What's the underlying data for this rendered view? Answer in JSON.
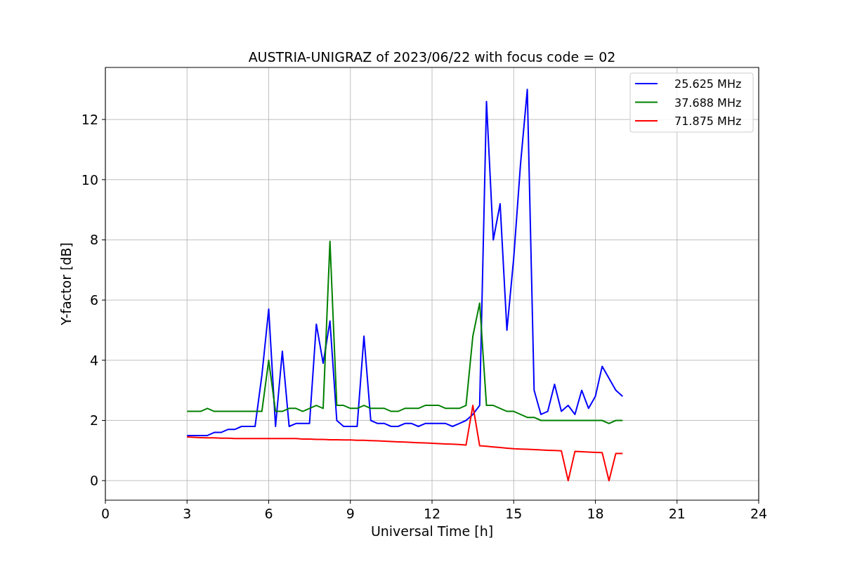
{
  "chart_data": {
    "type": "line",
    "title": "AUSTRIA-UNIGRAZ of 2023/06/22 with focus code = 02",
    "xlabel": "Universal Time [h]",
    "ylabel": "Y-factor [dB]",
    "x": [
      3,
      3.25,
      3.5,
      3.75,
      4,
      4.25,
      4.5,
      4.75,
      5,
      5.25,
      5.5,
      5.75,
      6,
      6.25,
      6.5,
      6.75,
      7,
      7.25,
      7.5,
      7.75,
      8,
      8.25,
      8.5,
      8.75,
      9,
      9.25,
      9.5,
      9.75,
      10,
      10.25,
      10.5,
      10.75,
      11,
      11.25,
      11.5,
      11.75,
      12,
      12.25,
      12.5,
      12.75,
      13,
      13.25,
      13.5,
      13.75,
      14,
      14.25,
      14.5,
      14.75,
      15,
      15.25,
      15.5,
      15.75,
      16,
      16.25,
      16.5,
      16.75,
      17,
      17.25,
      17.5,
      17.75,
      18,
      18.25,
      18.5,
      18.75,
      19
    ],
    "series": [
      {
        "name": "25.625 MHz",
        "color": "#0000ff",
        "values": [
          1.5,
          1.5,
          1.5,
          1.5,
          1.6,
          1.6,
          1.7,
          1.7,
          1.8,
          1.8,
          1.8,
          3.5,
          5.7,
          1.8,
          4.3,
          1.8,
          1.9,
          1.9,
          1.9,
          5.2,
          3.9,
          5.3,
          2.0,
          1.8,
          1.8,
          1.8,
          4.8,
          2.0,
          1.9,
          1.9,
          1.8,
          1.8,
          1.9,
          1.9,
          1.8,
          1.9,
          1.9,
          1.9,
          1.9,
          1.8,
          1.9,
          2.0,
          2.2,
          2.5,
          12.6,
          8.0,
          9.2,
          5.0,
          7.4,
          10.5,
          13.0,
          3.0,
          2.2,
          2.3,
          3.2,
          2.3,
          2.5,
          2.2,
          3.0,
          2.4,
          2.8,
          3.8,
          3.4,
          3.0,
          2.8
        ]
      },
      {
        "name": "37.688 MHz",
        "color": "#008000",
        "values": [
          2.3,
          2.3,
          2.3,
          2.4,
          2.3,
          2.3,
          2.3,
          2.3,
          2.3,
          2.3,
          2.3,
          2.3,
          4.0,
          2.3,
          2.3,
          2.4,
          2.4,
          2.3,
          2.4,
          2.5,
          2.4,
          7.95,
          2.5,
          2.5,
          2.4,
          2.4,
          2.5,
          2.4,
          2.4,
          2.4,
          2.3,
          2.3,
          2.4,
          2.4,
          2.4,
          2.5,
          2.5,
          2.5,
          2.4,
          2.4,
          2.4,
          2.5,
          4.8,
          5.9,
          2.5,
          2.5,
          2.4,
          2.3,
          2.3,
          2.2,
          2.1,
          2.1,
          2.0,
          2.0,
          2.0,
          2.0,
          2.0,
          2.0,
          2.0,
          2.0,
          2.0,
          2.0,
          1.9,
          2.0,
          2.0
        ]
      },
      {
        "name": "71.875 MHz",
        "color": "#ff0000",
        "values": [
          1.45,
          1.44,
          1.43,
          1.42,
          1.42,
          1.41,
          1.41,
          1.4,
          1.4,
          1.4,
          1.4,
          1.4,
          1.4,
          1.4,
          1.4,
          1.4,
          1.4,
          1.38,
          1.38,
          1.37,
          1.37,
          1.36,
          1.36,
          1.35,
          1.35,
          1.34,
          1.34,
          1.33,
          1.32,
          1.31,
          1.3,
          1.29,
          1.28,
          1.27,
          1.26,
          1.25,
          1.24,
          1.23,
          1.22,
          1.21,
          1.2,
          1.18,
          2.5,
          1.16,
          1.14,
          1.12,
          1.1,
          1.08,
          1.06,
          1.05,
          1.04,
          1.03,
          1.02,
          1.01,
          1.0,
          0.99,
          0.0,
          0.97,
          0.96,
          0.95,
          0.94,
          0.93,
          0.0,
          0.9,
          0.9
        ]
      }
    ],
    "xlim": [
      0,
      24
    ],
    "ylim": [
      -0.65,
      13.73
    ],
    "xticks": [
      0,
      3,
      6,
      9,
      12,
      15,
      18,
      21,
      24
    ],
    "yticks": [
      0,
      2,
      4,
      6,
      8,
      10,
      12
    ],
    "grid": true,
    "legend": true
  }
}
